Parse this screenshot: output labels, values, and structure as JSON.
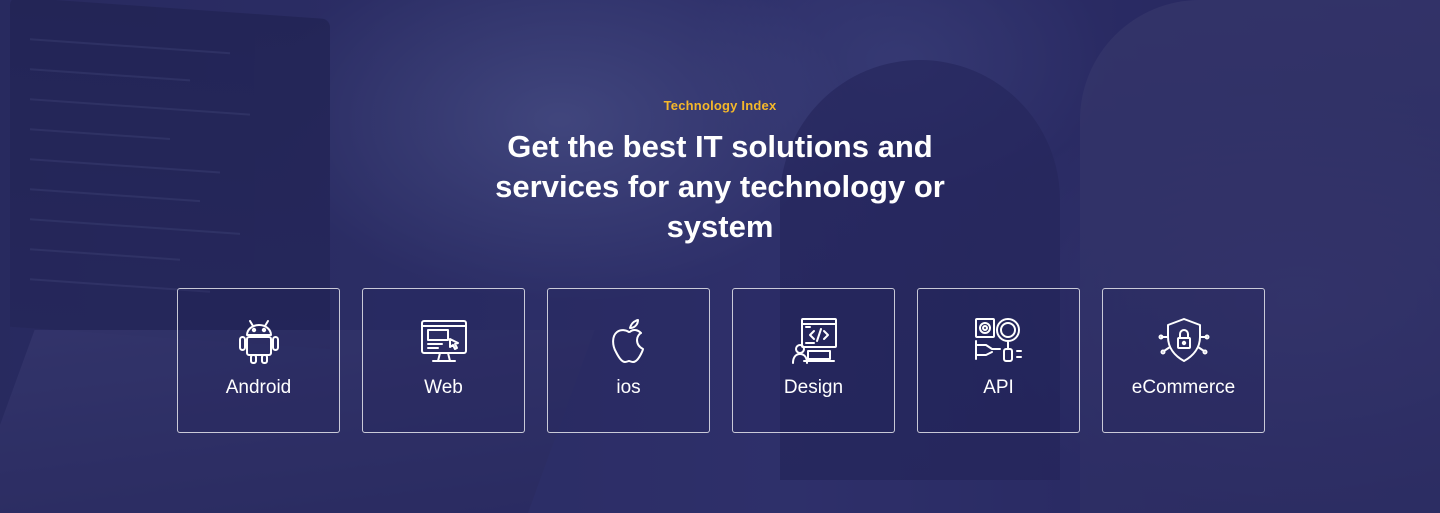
{
  "section": {
    "eyebrow": "Technology Index",
    "headline": "Get the best IT solutions and services for any technology or system"
  },
  "cards": [
    {
      "label": "Android",
      "icon": "android-icon"
    },
    {
      "label": "Web",
      "icon": "web-monitor-icon"
    },
    {
      "label": "ios",
      "icon": "apple-icon"
    },
    {
      "label": "Design",
      "icon": "design-code-icon"
    },
    {
      "label": "API",
      "icon": "api-gears-icon"
    },
    {
      "label": "eCommerce",
      "icon": "shield-lock-icon"
    }
  ],
  "colors": {
    "accent": "#f5b82a",
    "overlay": "#26265f",
    "text": "#ffffff"
  }
}
